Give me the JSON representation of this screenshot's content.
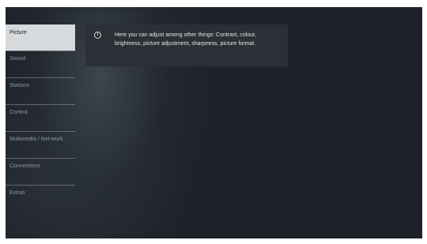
{
  "menu": {
    "items": [
      {
        "label": "Picture",
        "selected": true
      },
      {
        "label": "Sound",
        "selected": false
      },
      {
        "label": "Stations",
        "selected": false
      },
      {
        "label": "Control",
        "selected": false
      },
      {
        "label": "Multimedia / Net-work",
        "selected": false
      },
      {
        "label": "Connections",
        "selected": false
      },
      {
        "label": "Extras",
        "selected": false
      }
    ]
  },
  "info": {
    "icon": "info-icon",
    "text": "Here you can adjust among other things: Contrast, colour, brightness, picture adjustment, sharpness, picture format."
  },
  "colors": {
    "selected_bg": "#d6dadd",
    "screen_bg": "#1d2228",
    "panel_bg": "#2b3036"
  }
}
